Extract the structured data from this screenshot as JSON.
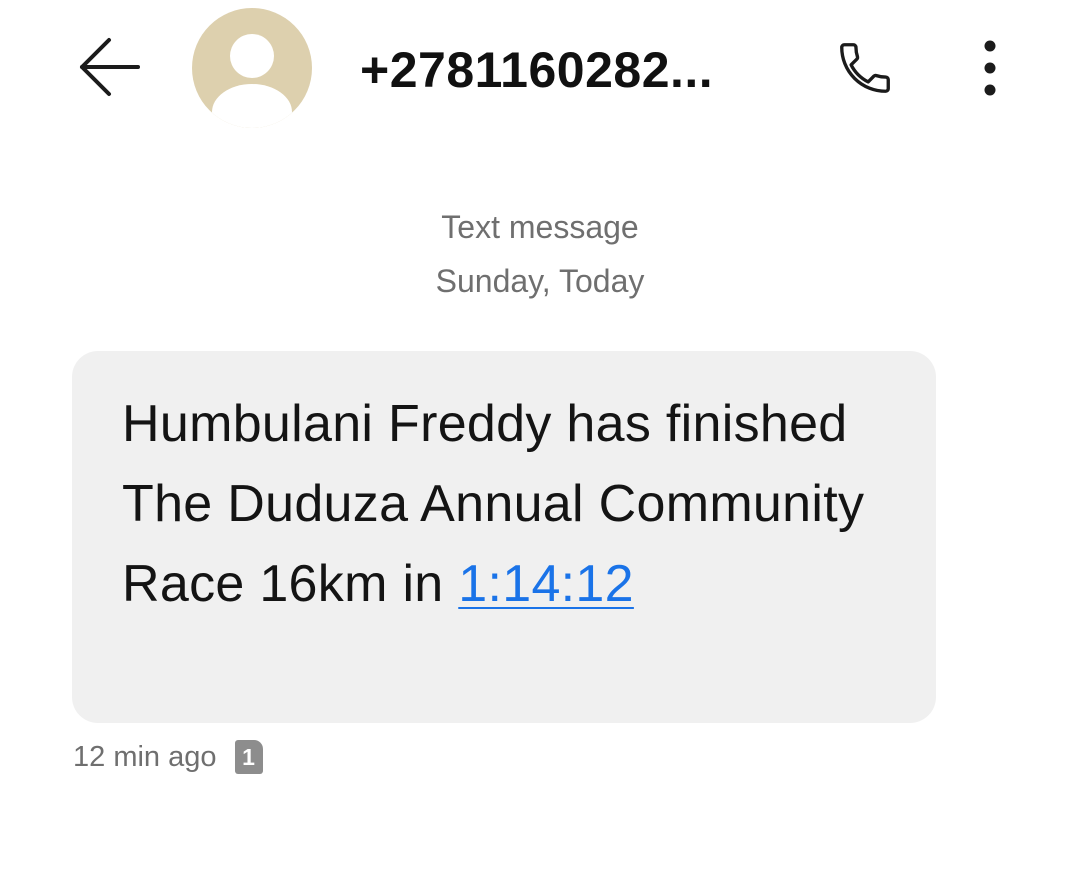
{
  "header": {
    "back_icon": "arrow-left-icon",
    "avatar_icon": "person-avatar-icon",
    "contact_name": "+2781160282...",
    "call_icon": "phone-icon",
    "more_icon": "more-vertical-icon",
    "avatar_color": "#ddd0ae"
  },
  "conversation": {
    "message_type": "Text message",
    "date_label": "Sunday, Today"
  },
  "message": {
    "text": "Humbulani Freddy has finished The Duduza Annual Community Race 16km in ",
    "link_text": "1:14:12",
    "time_ago": "12 min ago",
    "sim_badge": "1",
    "link_color": "#1a73e8",
    "bubble_color": "#f0f0f0"
  }
}
